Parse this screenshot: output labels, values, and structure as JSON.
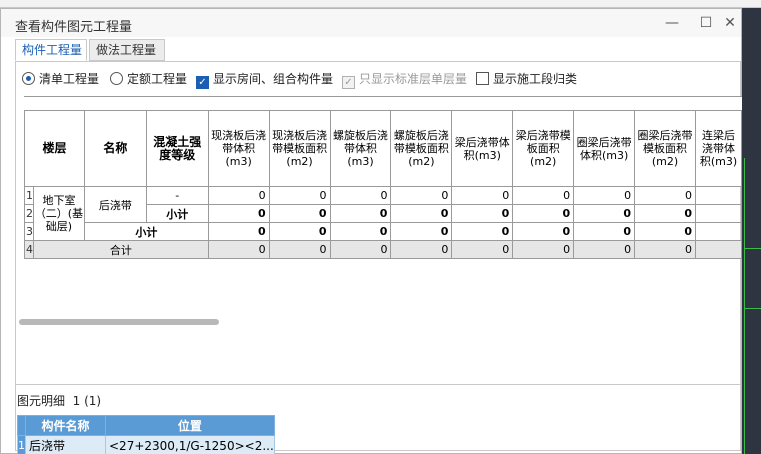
{
  "window": {
    "title": "查看构件图元工程量",
    "min_glyph": "—",
    "max_glyph": "☐",
    "close_glyph": "✕"
  },
  "tabs": [
    {
      "label": "构件工程量",
      "active": true
    },
    {
      "label": "做法工程量",
      "active": false
    }
  ],
  "options": {
    "radio_list": "清单工程量",
    "radio_quota": "定额工程量",
    "chk_show_rooms": "显示房间、组合构件量",
    "chk_std_floor": "只显示标准层单层量",
    "chk_construction": "显示施工段归类",
    "check_glyph": "✓"
  },
  "table": {
    "headers": {
      "floor": "楼层",
      "name": "名称",
      "grade": "混凝土强度等级",
      "c1": "现浇板后浇带体积(m3)",
      "c2": "现浇板后浇带模板面积(m2)",
      "c3": "螺旋板后浇带体积(m3)",
      "c4": "螺旋板后浇带模板面积(m2)",
      "c5": "梁后浇带体积(m3)",
      "c6": "梁后浇带模板面积(m2)",
      "c7": "圈梁后浇带体积(m3)",
      "c8": "圈梁后浇带模板面积(m2)",
      "c9": "连梁后浇带体积(m3)"
    },
    "row_numbers": [
      "1",
      "2",
      "3",
      "4"
    ],
    "floor_value": "地下室（二）(基础层)",
    "name_value": "后浇带",
    "grade_dash": "-",
    "subtotal_label": "小计",
    "total_label": "合计",
    "row1": [
      "0",
      "0",
      "0",
      "0",
      "0",
      "0",
      "0",
      "0"
    ],
    "row2": [
      "0",
      "0",
      "0",
      "0",
      "0",
      "0",
      "0",
      "0"
    ],
    "row3": [
      "0",
      "0",
      "0",
      "0",
      "0",
      "0",
      "0",
      "0"
    ],
    "row4": [
      "0",
      "0",
      "0",
      "0",
      "0",
      "0",
      "0",
      "0"
    ]
  },
  "detail": {
    "label": "图元明细",
    "count": "1 (1)",
    "headers": {
      "name": "构件名称",
      "pos": "位置"
    },
    "row_number": "1",
    "rows": [
      {
        "name": "后浇带",
        "pos": "<27+2300,1/G-1250><2..."
      }
    ]
  }
}
